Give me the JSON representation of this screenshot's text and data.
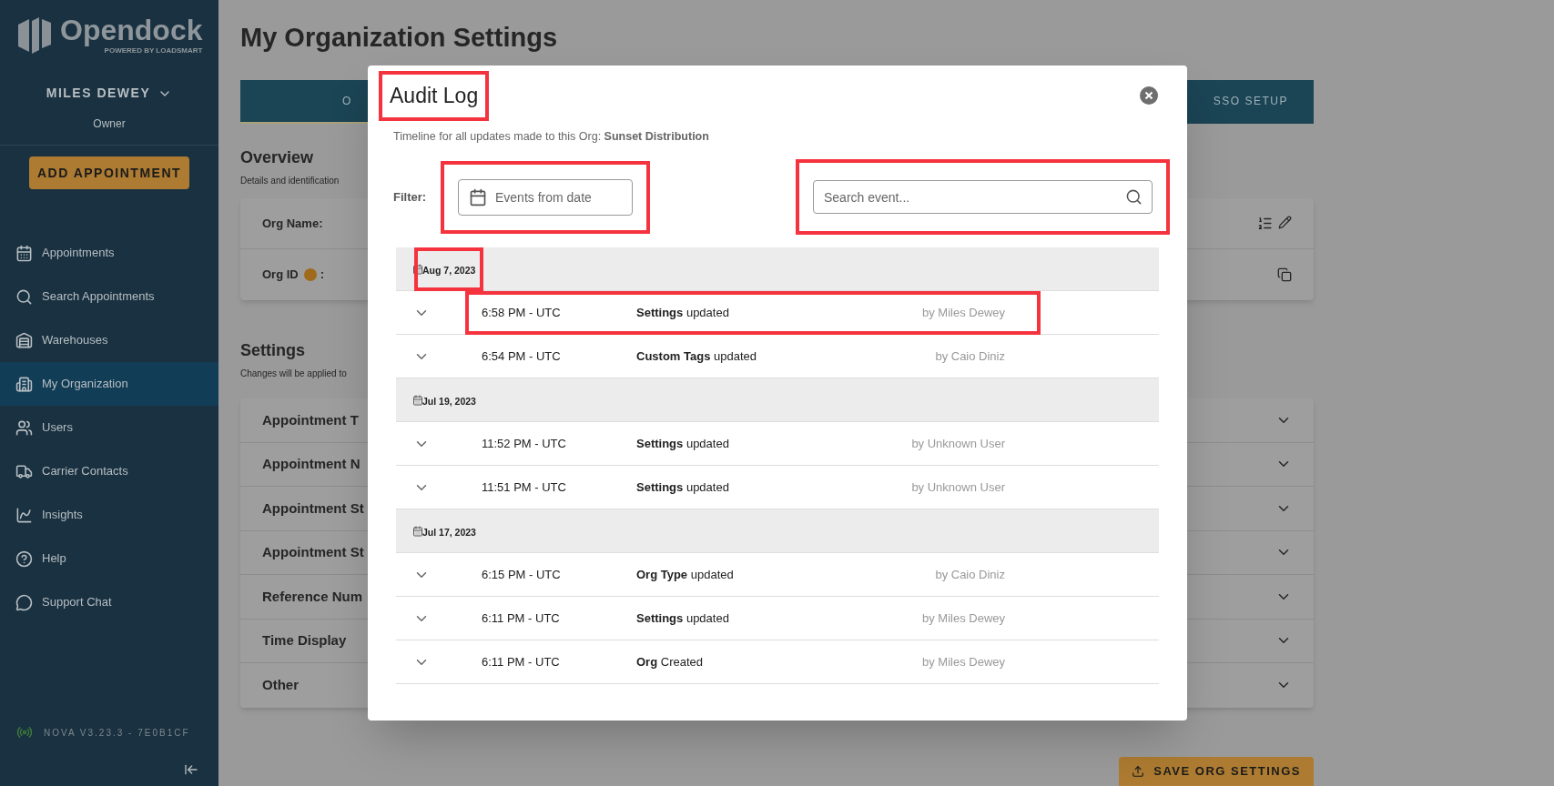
{
  "sidebar": {
    "logo": {
      "name": "Opendock",
      "tagline": "POWERED BY LOADSMART"
    },
    "user": {
      "name": "MILES DEWEY",
      "role": "Owner"
    },
    "add_button": "ADD APPOINTMENT",
    "items": [
      {
        "label": "Appointments",
        "selected": false
      },
      {
        "label": "Search Appointments",
        "selected": false
      },
      {
        "label": "Warehouses",
        "selected": false
      },
      {
        "label": "My Organization",
        "selected": true
      },
      {
        "label": "Users",
        "selected": false
      },
      {
        "label": "Carrier Contacts",
        "selected": false
      },
      {
        "label": "Insights",
        "selected": false
      },
      {
        "label": "Help",
        "selected": false
      },
      {
        "label": "Support Chat",
        "selected": false
      }
    ],
    "version": "NOVA V3.23.3 - 7E0B1CF"
  },
  "page": {
    "title": "My Organization Settings",
    "tabs": [
      {
        "label": "O",
        "selected": true
      },
      {
        "label": "SSO SETUP",
        "selected": false
      }
    ],
    "overview": {
      "title": "Overview",
      "subtitle": "Details and identification",
      "fields": [
        {
          "label": "Org Name:",
          "kind": "editable"
        },
        {
          "label": "Org ID",
          "suffix": ":",
          "kind": "copyable"
        }
      ]
    },
    "settings": {
      "title": "Settings",
      "subtitle": "Changes will be applied to",
      "sections": [
        "Appointment T",
        "Appointment N",
        "Appointment St",
        "Appointment St",
        "Reference Num",
        "Time Display",
        "Other"
      ]
    },
    "save_button": "SAVE ORG SETTINGS"
  },
  "modal": {
    "title": "Audit Log",
    "highlighted": true,
    "description": "Timeline for all updates made to this Org: **Sunset Distribution**",
    "filter_label": "Filter:",
    "date_filter": {
      "placeholder": "Events from date",
      "highlighted": true
    },
    "search": {
      "placeholder": "Search event...",
      "highlighted": true
    },
    "groups": [
      {
        "date": "Aug 7, 2023",
        "highlighted": true,
        "events": [
          {
            "time": "6:58 PM - UTC",
            "event": "**Settings** updated",
            "author": "by Miles Dewey",
            "highlighted": true
          },
          {
            "time": "6:54 PM - UTC",
            "event": "**Custom Tags** updated",
            "author": "by Caio Diniz",
            "highlighted": false
          }
        ]
      },
      {
        "date": "Jul 19, 2023",
        "highlighted": false,
        "events": [
          {
            "time": "11:52 PM - UTC",
            "event": "**Settings** updated",
            "author": "by Unknown User",
            "highlighted": false
          },
          {
            "time": "11:51 PM - UTC",
            "event": "**Settings** updated",
            "author": "by Unknown User",
            "highlighted": false
          }
        ]
      },
      {
        "date": "Jul 17, 2023",
        "highlighted": false,
        "events": [
          {
            "time": "6:15 PM - UTC",
            "event": "**Org Type** updated",
            "author": "by Caio Diniz",
            "highlighted": false
          },
          {
            "time": "6:11 PM - UTC",
            "event": "**Settings** updated",
            "author": "by Miles Dewey",
            "highlighted": false
          },
          {
            "time": "6:11 PM - UTC",
            "event": "**Org** Created",
            "author": "by Miles Dewey",
            "highlighted": false
          }
        ]
      }
    ]
  }
}
